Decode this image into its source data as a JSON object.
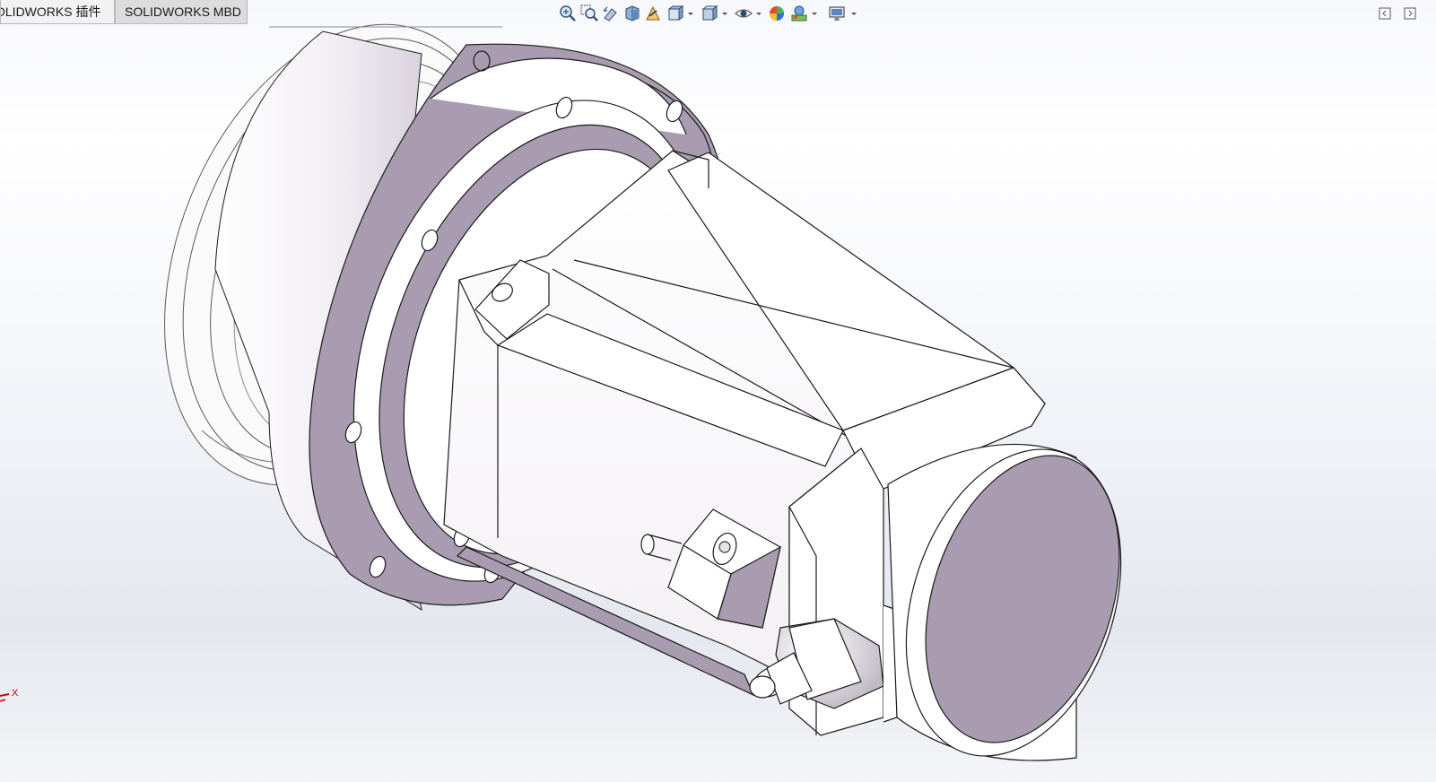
{
  "tabs": [
    {
      "label": "OLIDWORKS 插件",
      "active": false
    },
    {
      "label": "SOLIDWORKS MBD",
      "active": true
    }
  ],
  "heads_up_toolbar": {
    "icons": [
      "zoom-to-fit-icon",
      "zoom-to-area-icon",
      "previous-view-icon",
      "section-view-icon",
      "dynamic-annotation-view-icon",
      "view-orientation-icon",
      "display-style-icon",
      "hide-show-items-icon",
      "edit-appearance-icon",
      "apply-scene-icon",
      "view-settings-icon"
    ]
  },
  "window_controls": {
    "icons": [
      "restore-left-icon",
      "restore-right-icon"
    ]
  },
  "triad": {
    "x_label": "X"
  },
  "colors": {
    "face_purple": "#aa9cb0",
    "face_white": "#ffffff",
    "edge": "#1a1a1a",
    "ghost_edge": "#7a7a7a"
  }
}
